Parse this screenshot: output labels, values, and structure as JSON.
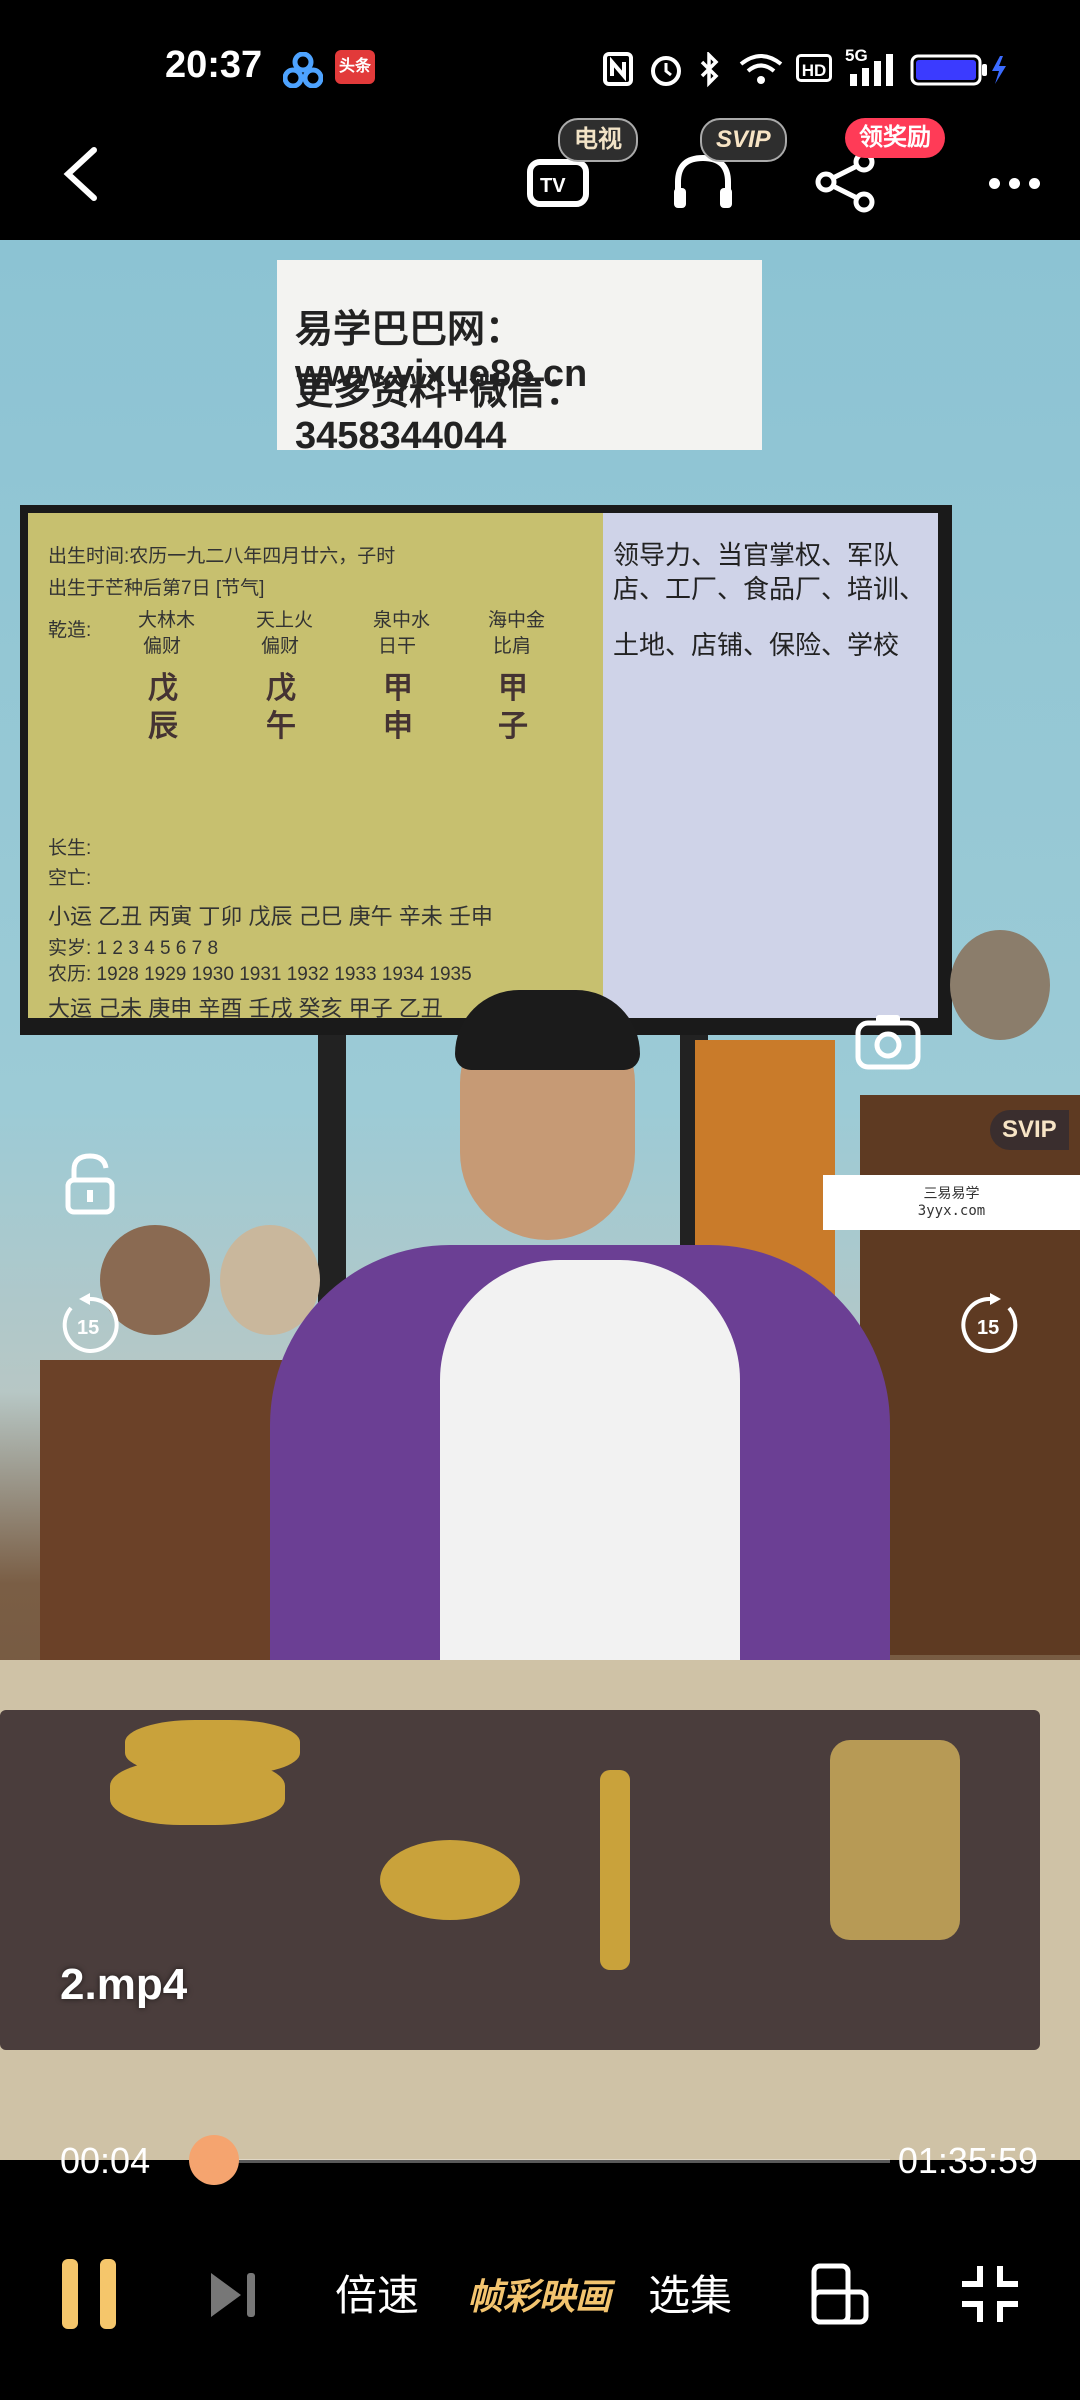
{
  "status_bar": {
    "time": "20:37",
    "app_badge": "头条",
    "network": "5G",
    "hd": "HD"
  },
  "top_bar": {
    "tv_badge": "电视",
    "svip_badge": "SVIP",
    "reward_badge": "领奖励"
  },
  "video": {
    "banner_line1": "易学巴巴网：www.yixue88.cn",
    "banner_line2": "更多资料+微信：3458344044",
    "screen_left": {
      "line1": "出生时间:农历一九二八年四月廿六，子时",
      "line2": "出生于芒种后第7日 [节气]",
      "row_labels": [
        "乾造:",
        "长生:",
        "空亡:"
      ],
      "col_heads": [
        "大林木",
        "天上火",
        "泉中水",
        "海中金"
      ],
      "col_roles": [
        "偏财",
        "偏财",
        "日干",
        "比肩"
      ],
      "stems": [
        "戊",
        "戊",
        "甲",
        "甲"
      ],
      "branches": [
        "辰",
        "午",
        "申",
        "子"
      ],
      "luck_row": "小运 乙丑 丙寅 丁卯 戊辰 己巳 庚午 辛未 壬申",
      "age_row": "实岁: 1 2 3 4 5 6 7 8",
      "year_row": "农历: 1928 1929 1930 1931 1932 1933 1934 1935",
      "bottom_row": "大运 己未 庚申 辛酉 壬戌 癸亥 甲子 乙丑"
    },
    "screen_right": {
      "line1": "领导力、当官掌权、军队",
      "line2": "店、工厂、食品厂、培训、",
      "line3": "土地、店铺、保险、学校"
    },
    "watermark_line1": "三易易学",
    "watermark_line2": "3yyx.com",
    "side_svip": "SVIP",
    "rewind_seconds": "15",
    "forward_seconds": "15",
    "filename": "2.mp4"
  },
  "progress": {
    "current": "00:04",
    "total": "01:35:59",
    "fraction": 0.001
  },
  "bottom_bar": {
    "speed_label": "倍速",
    "brand_label": "帧彩映画",
    "episodes_label": "选集"
  },
  "colors": {
    "knob": "#f5a46f",
    "reward_pill": "#ff3b57",
    "svip_pill": "#3a2e2e",
    "battery": "#3b3bff"
  }
}
